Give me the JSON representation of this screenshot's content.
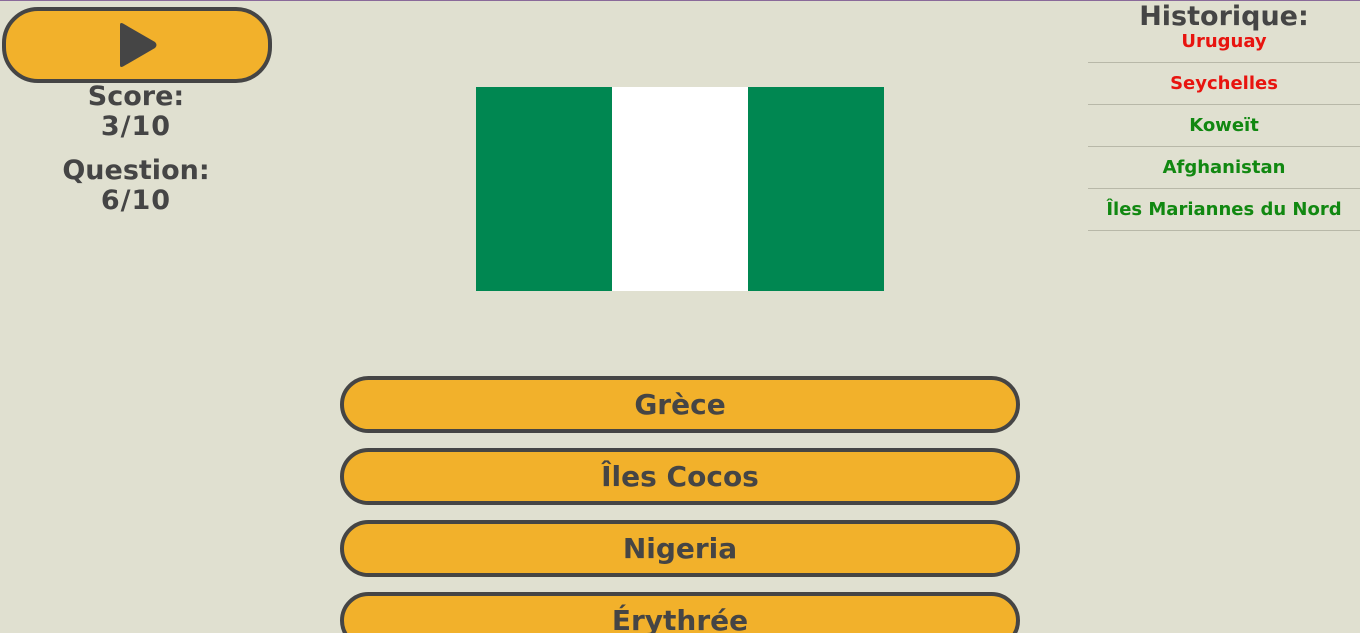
{
  "colors": {
    "background": "#e0e0d0",
    "button": "#f2b12b",
    "text": "#454545",
    "correct": "#118811",
    "wrong": "#e8140f"
  },
  "play_button": {
    "icon": "play-icon"
  },
  "score": {
    "label": "Score:",
    "value": "3/10"
  },
  "question": {
    "label": "Question:",
    "value": "6/10"
  },
  "flag": {
    "stripes": [
      "#008751",
      "#ffffff",
      "#008751"
    ]
  },
  "history": {
    "title": "Historique:",
    "items": [
      {
        "label": "Uruguay",
        "color": "#e8140f"
      },
      {
        "label": "Seychelles",
        "color": "#e8140f"
      },
      {
        "label": "Koweït",
        "color": "#118811"
      },
      {
        "label": "Afghanistan",
        "color": "#118811"
      },
      {
        "label": "Îles Mariannes du Nord",
        "color": "#118811"
      }
    ]
  },
  "answers": [
    "Grèce",
    "Îles Cocos",
    "Nigeria",
    "Érythrée"
  ]
}
